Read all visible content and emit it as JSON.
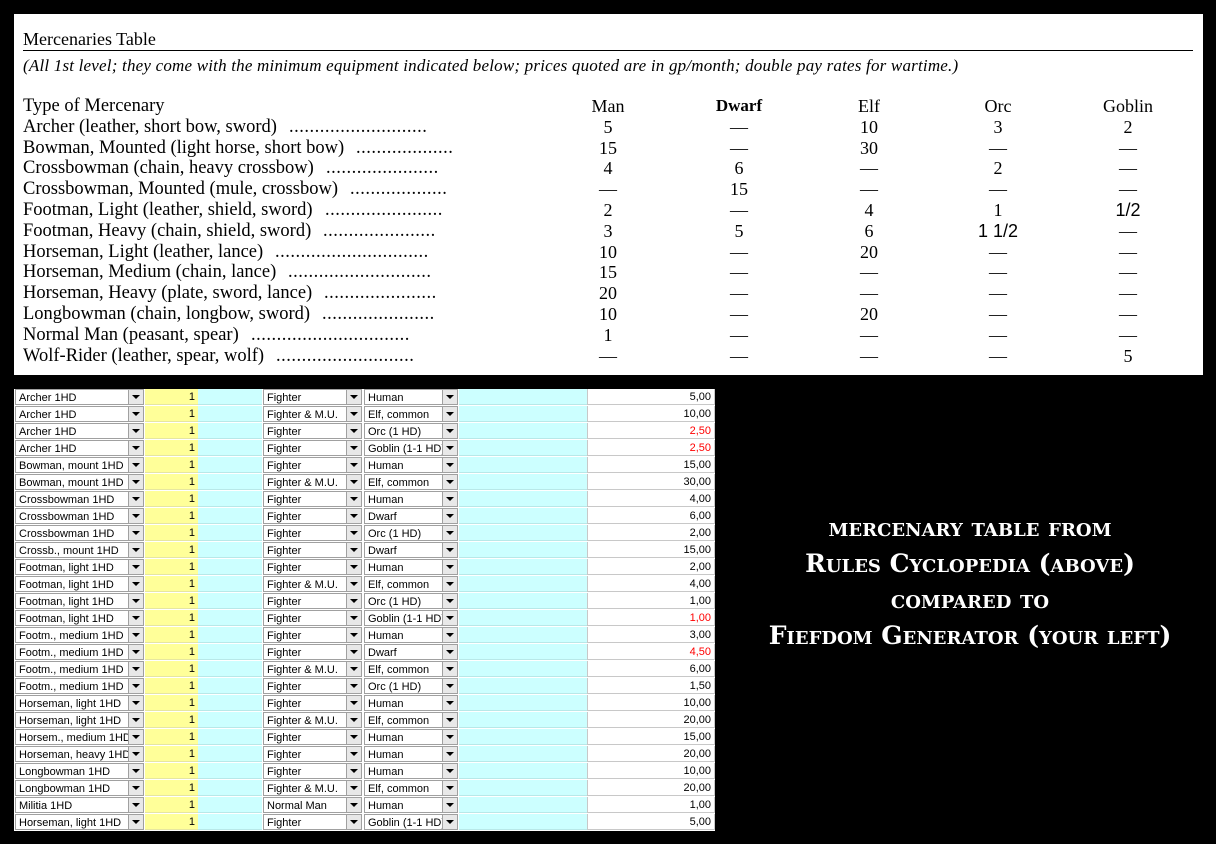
{
  "book": {
    "title": "Mercenaries Table",
    "subtitle": "(All 1st level; they come with the minimum equipment indicated below; prices quoted are in gp/month; double pay rates for wartime.)",
    "header": {
      "type": "Type of Mercenary",
      "man": "Man",
      "dwarf": "Dwarf",
      "elf": "Elf",
      "orc": "Orc",
      "goblin": "Goblin"
    },
    "rows": [
      {
        "name": "Archer (leather, short bow, sword)",
        "dots": "...........................",
        "man": "5",
        "dwarf": "—",
        "elf": "10",
        "orc": "3",
        "goblin": "2"
      },
      {
        "name": "Bowman, Mounted (light horse, short bow)",
        "dots": "...................",
        "man": "15",
        "dwarf": "—",
        "elf": "30",
        "orc": "—",
        "goblin": "—"
      },
      {
        "name": "Crossbowman (chain, heavy crossbow)",
        "dots": "......................",
        "man": "4",
        "dwarf": "6",
        "elf": "—",
        "orc": "2",
        "goblin": "—"
      },
      {
        "name": "Crossbowman, Mounted (mule, crossbow)",
        "dots": "...................",
        "man": "—",
        "dwarf": "15",
        "elf": "—",
        "orc": "—",
        "goblin": "—"
      },
      {
        "name": "Footman, Light (leather, shield, sword)",
        "dots": ".......................",
        "man": "2",
        "dwarf": "—",
        "elf": "4",
        "orc": "1",
        "goblin": "1/2"
      },
      {
        "name": "Footman, Heavy (chain, shield, sword)",
        "dots": "......................",
        "man": "3",
        "dwarf": "5",
        "elf": "6",
        "orc": "1 1/2",
        "goblin": "—"
      },
      {
        "name": "Horseman, Light (leather, lance)",
        "dots": "..............................",
        "man": "10",
        "dwarf": "—",
        "elf": "20",
        "orc": "—",
        "goblin": "—"
      },
      {
        "name": "Horseman, Medium (chain, lance)",
        "dots": "............................",
        "man": "15",
        "dwarf": "—",
        "elf": "—",
        "orc": "—",
        "goblin": "—"
      },
      {
        "name": "Horseman, Heavy (plate, sword, lance)",
        "dots": "......................",
        "man": "20",
        "dwarf": "—",
        "elf": "—",
        "orc": "—",
        "goblin": "—"
      },
      {
        "name": "Longbowman (chain, longbow, sword)",
        "dots": "......................",
        "man": "10",
        "dwarf": "—",
        "elf": "20",
        "orc": "—",
        "goblin": "—"
      },
      {
        "name": "Normal Man (peasant, spear)",
        "dots": "...............................",
        "man": "1",
        "dwarf": "—",
        "elf": "—",
        "orc": "—",
        "goblin": "—"
      },
      {
        "name": "Wolf-Rider (leather, spear, wolf)",
        "dots": "...........................",
        "man": "—",
        "dwarf": "—",
        "elf": "—",
        "orc": "—",
        "goblin": "5"
      }
    ]
  },
  "sheet": {
    "rows": [
      {
        "type": "Archer 1HD",
        "qty": "1",
        "cls": "Fighter",
        "race": "Human",
        "price": "5,00",
        "red": false
      },
      {
        "type": "Archer 1HD",
        "qty": "1",
        "cls": "Fighter & M.U.",
        "race": "Elf, common",
        "price": "10,00",
        "red": false
      },
      {
        "type": "Archer 1HD",
        "qty": "1",
        "cls": "Fighter",
        "race": "Orc (1 HD)",
        "price": "2,50",
        "red": true
      },
      {
        "type": "Archer 1HD",
        "qty": "1",
        "cls": "Fighter",
        "race": "Goblin (1-1 HD)",
        "price": "2,50",
        "red": true
      },
      {
        "type": "Bowman, mount 1HD",
        "qty": "1",
        "cls": "Fighter",
        "race": "Human",
        "price": "15,00",
        "red": false
      },
      {
        "type": "Bowman, mount 1HD",
        "qty": "1",
        "cls": "Fighter & M.U.",
        "race": "Elf, common",
        "price": "30,00",
        "red": false
      },
      {
        "type": "Crossbowman 1HD",
        "qty": "1",
        "cls": "Fighter",
        "race": "Human",
        "price": "4,00",
        "red": false
      },
      {
        "type": "Crossbowman 1HD",
        "qty": "1",
        "cls": "Fighter",
        "race": "Dwarf",
        "price": "6,00",
        "red": false
      },
      {
        "type": "Crossbowman 1HD",
        "qty": "1",
        "cls": "Fighter",
        "race": "Orc (1 HD)",
        "price": "2,00",
        "red": false
      },
      {
        "type": "Crossb., mount 1HD",
        "qty": "1",
        "cls": "Fighter",
        "race": "Dwarf",
        "price": "15,00",
        "red": false
      },
      {
        "type": "Footman, light 1HD",
        "qty": "1",
        "cls": "Fighter",
        "race": "Human",
        "price": "2,00",
        "red": false
      },
      {
        "type": "Footman, light 1HD",
        "qty": "1",
        "cls": "Fighter & M.U.",
        "race": "Elf, common",
        "price": "4,00",
        "red": false
      },
      {
        "type": "Footman, light 1HD",
        "qty": "1",
        "cls": "Fighter",
        "race": "Orc (1 HD)",
        "price": "1,00",
        "red": false
      },
      {
        "type": "Footman, light 1HD",
        "qty": "1",
        "cls": "Fighter",
        "race": "Goblin (1-1 HD)",
        "price": "1,00",
        "red": true
      },
      {
        "type": "Footm., medium 1HD",
        "qty": "1",
        "cls": "Fighter",
        "race": "Human",
        "price": "3,00",
        "red": false
      },
      {
        "type": "Footm., medium 1HD",
        "qty": "1",
        "cls": "Fighter",
        "race": "Dwarf",
        "price": "4,50",
        "red": true
      },
      {
        "type": "Footm., medium 1HD",
        "qty": "1",
        "cls": "Fighter & M.U.",
        "race": "Elf, common",
        "price": "6,00",
        "red": false
      },
      {
        "type": "Footm., medium 1HD",
        "qty": "1",
        "cls": "Fighter",
        "race": "Orc (1 HD)",
        "price": "1,50",
        "red": false
      },
      {
        "type": "Horseman, light 1HD",
        "qty": "1",
        "cls": "Fighter",
        "race": "Human",
        "price": "10,00",
        "red": false
      },
      {
        "type": "Horseman, light 1HD",
        "qty": "1",
        "cls": "Fighter & M.U.",
        "race": "Elf, common",
        "price": "20,00",
        "red": false
      },
      {
        "type": "Horsem., medium 1HD",
        "qty": "1",
        "cls": "Fighter",
        "race": "Human",
        "price": "15,00",
        "red": false
      },
      {
        "type": "Horseman, heavy 1HD",
        "qty": "1",
        "cls": "Fighter",
        "race": "Human",
        "price": "20,00",
        "red": false
      },
      {
        "type": "Longbowman 1HD",
        "qty": "1",
        "cls": "Fighter",
        "race": "Human",
        "price": "10,00",
        "red": false
      },
      {
        "type": "Longbowman 1HD",
        "qty": "1",
        "cls": "Fighter & M.U.",
        "race": "Elf, common",
        "price": "20,00",
        "red": false
      },
      {
        "type": "Militia 1HD",
        "qty": "1",
        "cls": "Normal Man",
        "race": "Human",
        "price": "1,00",
        "red": false
      },
      {
        "type": "Horseman, light 1HD",
        "qty": "1",
        "cls": "Fighter",
        "race": "Goblin (1-1 HD)",
        "price": "5,00",
        "red": false
      }
    ]
  },
  "caption": {
    "line1": "mercenary table from",
    "line2": "Rules Cyclopedia (above)",
    "line3": "compared to",
    "line4": "Fiefdom Generator (your left)"
  },
  "colors": {
    "qty_bg": "#ffff99",
    "cyan_bg": "#ccffff",
    "red_price": "#ff0000",
    "background": "#000000"
  }
}
